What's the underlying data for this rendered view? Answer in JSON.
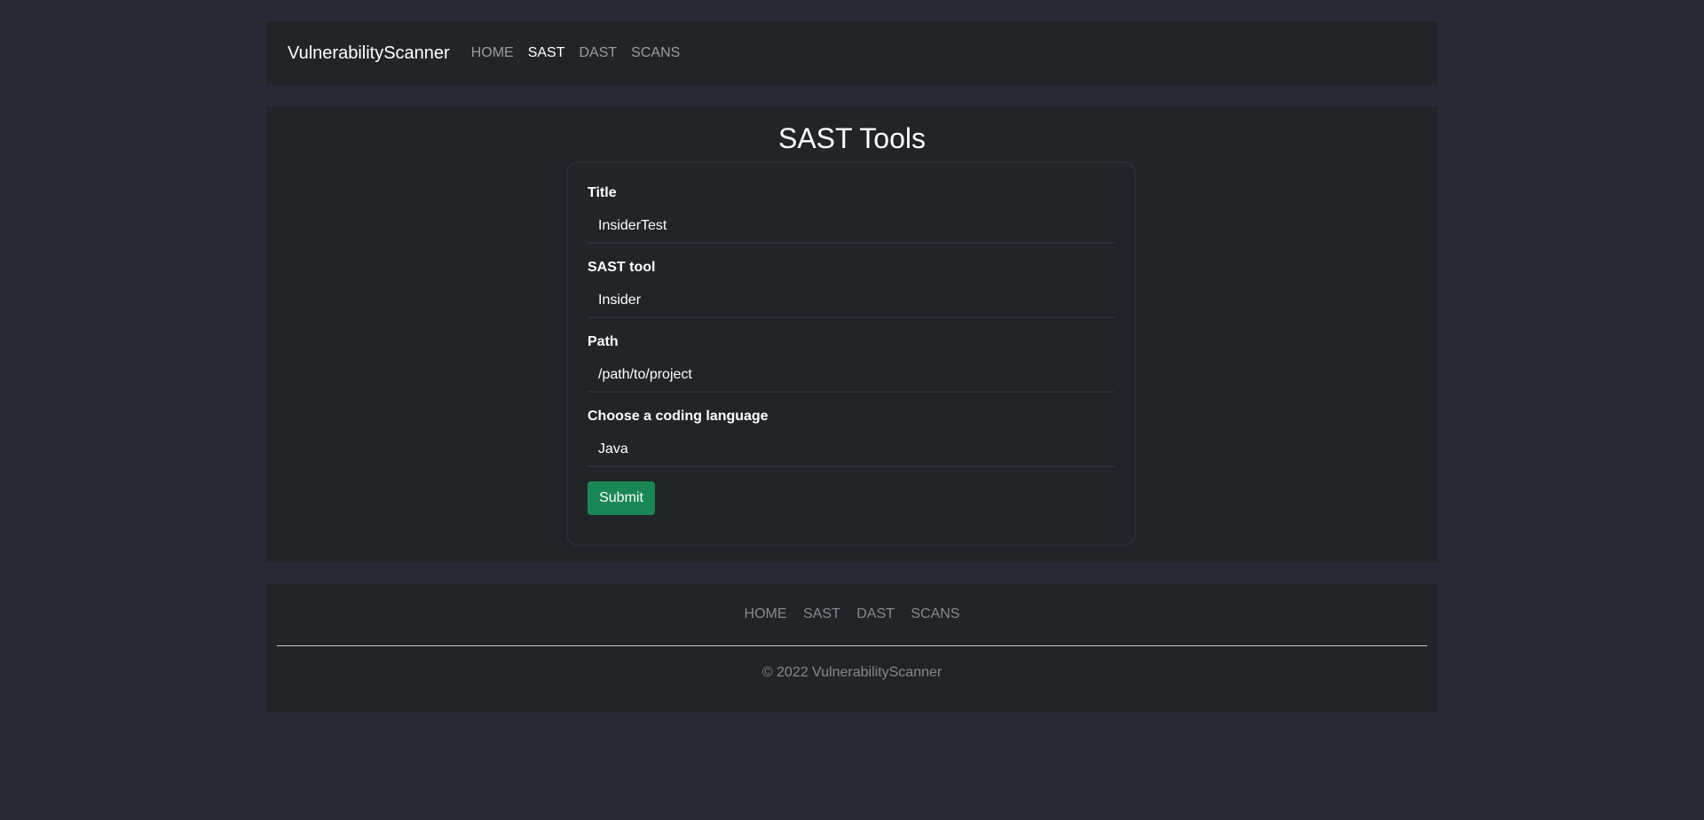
{
  "navbar": {
    "brand": "VulnerabilityScanner",
    "links": [
      "HOME",
      "SAST",
      "DAST",
      "SCANS"
    ],
    "active": "SAST"
  },
  "main": {
    "title": "SAST Tools",
    "form": {
      "title_label": "Title",
      "title_value": "InsiderTest",
      "tool_label": "SAST tool",
      "tool_value": "Insider",
      "path_label": "Path",
      "path_value": "/path/to/project",
      "language_label": "Choose a coding language",
      "language_value": "Java",
      "submit_label": "Submit"
    }
  },
  "footer": {
    "links": [
      "HOME",
      "SAST",
      "DAST",
      "SCANS"
    ],
    "copyright": "© 2022 VulnerabilityScanner"
  },
  "colors": {
    "page_background": "#272a36",
    "panel_background": "#212429",
    "submit_button": "#198754"
  }
}
